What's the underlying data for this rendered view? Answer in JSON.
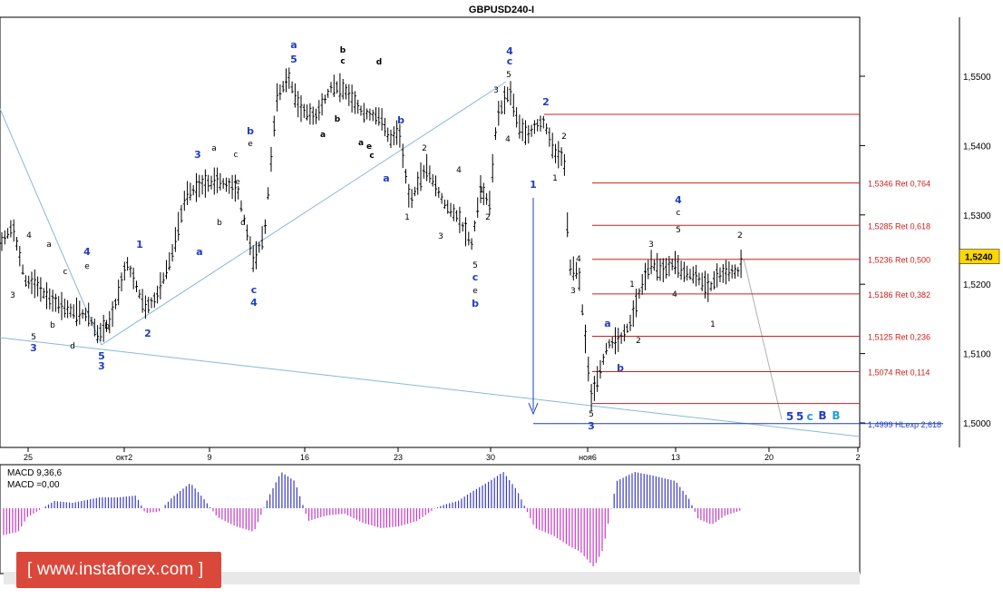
{
  "title": "GBPUSD240-I",
  "chart_data": {
    "type": "candlestick",
    "symbol": "GBPUSD240-I",
    "ylim": [
      1.4975,
      1.5595
    ],
    "yticks": [
      {
        "v": 1.55,
        "t": "1,5500"
      },
      {
        "v": 1.54,
        "t": "1,5400"
      },
      {
        "v": 1.53,
        "t": "1,5300"
      },
      {
        "v": 1.52,
        "t": "1,5200"
      },
      {
        "v": 1.51,
        "t": "1,5100"
      },
      {
        "v": 1.5,
        "t": "1,5000"
      }
    ],
    "xticks": [
      "25",
      "окт2",
      "9",
      "16",
      "23",
      "30",
      "ноя6",
      "13",
      "20",
      "2"
    ],
    "current_price": {
      "v": 1.524,
      "t": "1,5240"
    },
    "fib_levels": [
      {
        "v": 1.5445,
        "label": ""
      },
      {
        "v": 1.5346,
        "label": "1,5346 Ret 0,764"
      },
      {
        "v": 1.5285,
        "label": "1,5285 Ret 0,618"
      },
      {
        "v": 1.5236,
        "label": "1,5236 Ret 0,500"
      },
      {
        "v": 1.5186,
        "label": "1,5186 Ret 0,382"
      },
      {
        "v": 1.5125,
        "label": "1,5125 Ret 0,236"
      },
      {
        "v": 1.5074,
        "label": "1,5074 Ret 0,114"
      },
      {
        "v": 1.5028,
        "label": ""
      },
      {
        "v": 1.4999,
        "label": "1,4999 HLexp 2,618"
      }
    ],
    "wave_labels": [
      {
        "t": "4",
        "c": "black"
      },
      {
        "t": "a",
        "c": "black"
      },
      {
        "t": "3",
        "c": "black"
      },
      {
        "t": "c",
        "c": "black"
      },
      {
        "t": "b",
        "c": "black"
      },
      {
        "t": "5",
        "c": "black"
      },
      {
        "t": "3",
        "c": "blue"
      },
      {
        "t": "d",
        "c": "black"
      },
      {
        "t": "4",
        "c": "blue"
      },
      {
        "t": "e",
        "c": "black"
      },
      {
        "t": "5",
        "c": "blue"
      },
      {
        "t": "3",
        "c": "blue"
      },
      {
        "t": "1",
        "c": "blue"
      },
      {
        "t": "2",
        "c": "blue"
      },
      {
        "t": "b",
        "c": "black"
      },
      {
        "t": "a",
        "c": "blue"
      },
      {
        "t": "3",
        "c": "blue"
      },
      {
        "t": "a",
        "c": "black"
      },
      {
        "t": "c",
        "c": "black"
      },
      {
        "t": "e",
        "c": "black"
      },
      {
        "t": "b",
        "c": "black"
      },
      {
        "t": "d",
        "c": "black"
      },
      {
        "t": "b",
        "c": "blue"
      },
      {
        "t": "e",
        "c": "black"
      },
      {
        "t": "c",
        "c": "blue"
      },
      {
        "t": "4",
        "c": "blue"
      },
      {
        "t": "a",
        "c": "blue"
      },
      {
        "t": "5",
        "c": "blue"
      },
      {
        "t": "b",
        "c": "black"
      },
      {
        "t": "c",
        "c": "black"
      },
      {
        "t": "d",
        "c": "black"
      },
      {
        "t": "a",
        "c": "black"
      },
      {
        "t": "b",
        "c": "black"
      },
      {
        "t": "e",
        "c": "black"
      },
      {
        "t": "a",
        "c": "black"
      },
      {
        "t": "c",
        "c": "black"
      },
      {
        "t": "b",
        "c": "blue"
      },
      {
        "t": "a",
        "c": "blue"
      },
      {
        "t": "2",
        "c": "black"
      },
      {
        "t": "1",
        "c": "black"
      },
      {
        "t": "4",
        "c": "black"
      },
      {
        "t": "3",
        "c": "black"
      },
      {
        "t": "1",
        "c": "black"
      },
      {
        "t": "2",
        "c": "black"
      },
      {
        "t": "5",
        "c": "black"
      },
      {
        "t": "c",
        "c": "blue"
      },
      {
        "t": "e",
        "c": "black"
      },
      {
        "t": "b",
        "c": "blue"
      },
      {
        "t": "4",
        "c": "blue"
      },
      {
        "t": "c",
        "c": "blue"
      },
      {
        "t": "5",
        "c": "black"
      },
      {
        "t": "3",
        "c": "black"
      },
      {
        "t": "4",
        "c": "black"
      },
      {
        "t": "2",
        "c": "blue"
      },
      {
        "t": "1",
        "c": "blue"
      },
      {
        "t": "2",
        "c": "black"
      },
      {
        "t": "1",
        "c": "black"
      },
      {
        "t": "4",
        "c": "black"
      },
      {
        "t": "3",
        "c": "black"
      },
      {
        "t": "5",
        "c": "black"
      },
      {
        "t": "3",
        "c": "blue"
      },
      {
        "t": "a",
        "c": "blue"
      },
      {
        "t": "b",
        "c": "blue"
      },
      {
        "t": "1",
        "c": "black"
      },
      {
        "t": "2",
        "c": "black"
      },
      {
        "t": "3",
        "c": "black"
      },
      {
        "t": "4",
        "c": "black"
      },
      {
        "t": "4",
        "c": "blue"
      },
      {
        "t": "c",
        "c": "black"
      },
      {
        "t": "5",
        "c": "black"
      },
      {
        "t": "1",
        "c": "black"
      },
      {
        "t": "2",
        "c": "black"
      },
      {
        "t": "5",
        "c": "blue"
      },
      {
        "t": "5",
        "c": "blue"
      },
      {
        "t": "c",
        "c": "cyan"
      },
      {
        "t": "B",
        "c": "blue"
      },
      {
        "t": "B",
        "c": "cyan"
      }
    ],
    "macd": {
      "label1": "MACD 9,36,6",
      "label2": "MACD =0,00"
    },
    "colors": {
      "fib": "#cc2020",
      "trend": "#87b8d8",
      "blue": "#1f3fbf",
      "cyan": "#1ea0d0",
      "macd_pos": "#3a3ac8",
      "macd_neg": "#c83ac8",
      "price_box": "#ffd700"
    }
  },
  "watermark": "[ www.instaforex.com ]"
}
